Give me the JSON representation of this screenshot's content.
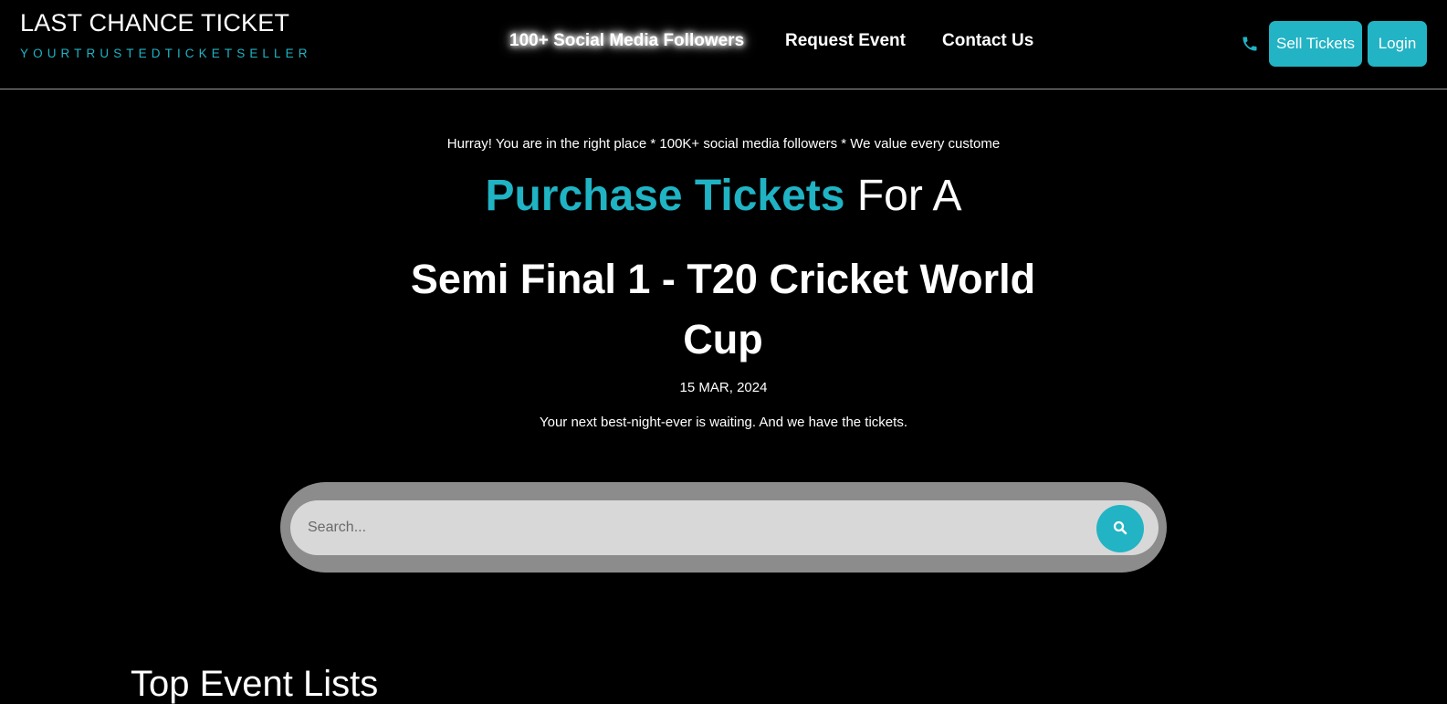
{
  "brand": {
    "title": "LAST CHANCE TICKET",
    "tagline": "YOURTRUSTEDTICKETSELLER"
  },
  "nav": {
    "followers": "100+ Social Media Followers",
    "request_event": "Request Event",
    "contact_us": "Contact Us"
  },
  "actions": {
    "phone_icon": "phone-icon",
    "sell_tickets": "Sell Tickets",
    "login": "Login"
  },
  "hero": {
    "tagline": "Hurray! You are in the right place * 100K+ social media followers * We value every custome",
    "headline_accent": "Purchase Tickets",
    "headline_rest": " For A",
    "event_title": "Semi Final 1 - T20 Cricket World Cup",
    "event_date": "15 MAR, 2024",
    "subtext": "Your next best-night-ever is waiting. And we have the tickets."
  },
  "search": {
    "placeholder": "Search...",
    "icon": "search-icon"
  },
  "section": {
    "title": "Top Event Lists"
  },
  "colors": {
    "accent": "#1fb3c4",
    "background": "#000000",
    "search_outer": "#8c8c8c",
    "search_inner": "#d8d8d8"
  }
}
